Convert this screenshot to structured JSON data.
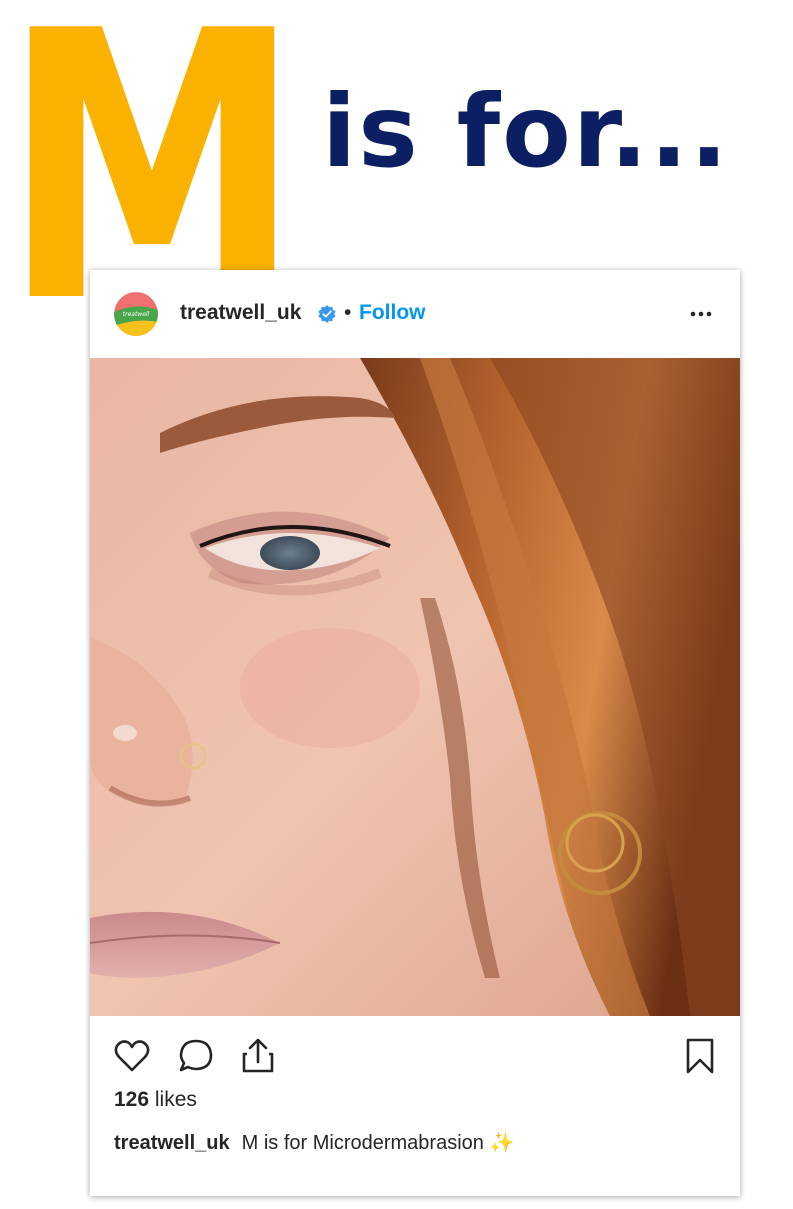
{
  "heading": {
    "letter": "M",
    "rest": "is for...",
    "letter_color": "#fbb100",
    "text_color": "#0c1f63"
  },
  "post": {
    "avatar_text": "treatwell",
    "username": "treatwell_uk",
    "verified_icon": "verified-badge-icon",
    "separator": "•",
    "follow_label": "Follow",
    "more_icon": "more-options-icon",
    "photo_alt": "Close-up of a face with auburn hair, nose ring and hoop earrings",
    "actions": {
      "like_icon": "heart-icon",
      "comment_icon": "comment-icon",
      "share_icon": "share-icon",
      "save_icon": "bookmark-icon"
    },
    "likes_count": "126",
    "likes_label": "likes",
    "caption_user": "treatwell_uk",
    "caption_text": "M is for Microdermabrasion",
    "caption_emoji": "✨",
    "colors": {
      "follow": "#0095f6",
      "text": "#262626",
      "verified": "#3897f0"
    }
  }
}
